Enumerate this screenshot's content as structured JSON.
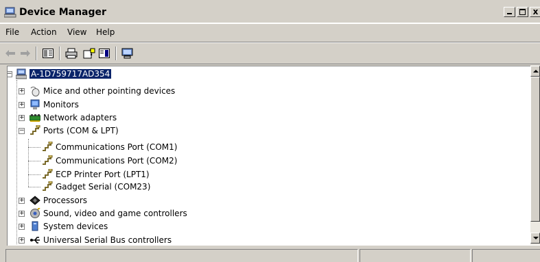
{
  "window": {
    "title": "Device Manager",
    "close_glyph": "x",
    "icon": "computer-icon"
  },
  "menu": {
    "items": [
      {
        "label": "File"
      },
      {
        "label": "Action"
      },
      {
        "label": "View"
      },
      {
        "label": "Help"
      }
    ]
  },
  "toolbar": {
    "icons": [
      "back-arrow-icon",
      "forward-arrow-icon",
      "show-hide-console-tree-icon",
      "print-icon",
      "help-icon",
      "properties-icon",
      "scan-hardware-icon"
    ]
  },
  "tree": {
    "root": {
      "label": "A-1D759717AD354",
      "icon": "computer-icon",
      "selected": true
    },
    "categories": [
      {
        "label": "Mice and other pointing devices",
        "icon": "mouse-icon",
        "expanded": false
      },
      {
        "label": "Monitors",
        "icon": "monitor-icon",
        "expanded": false
      },
      {
        "label": "Network adapters",
        "icon": "network-adapter-icon",
        "expanded": false
      },
      {
        "label": "Ports (COM & LPT)",
        "icon": "port-icon",
        "expanded": true,
        "children": [
          {
            "label": "Communications Port (COM1)",
            "icon": "port-icon"
          },
          {
            "label": "Communications Port (COM2)",
            "icon": "port-icon"
          },
          {
            "label": "ECP Printer Port (LPT1)",
            "icon": "port-icon"
          },
          {
            "label": "Gadget Serial (COM23)",
            "icon": "port-icon"
          }
        ]
      },
      {
        "label": "Processors",
        "icon": "processor-icon",
        "expanded": false
      },
      {
        "label": "Sound, video and game controllers",
        "icon": "sound-icon",
        "expanded": false
      },
      {
        "label": "System devices",
        "icon": "system-devices-icon",
        "expanded": false
      },
      {
        "label": "Universal Serial Bus controllers",
        "icon": "usb-icon",
        "expanded": false
      }
    ],
    "expander_collapsed": "+",
    "expander_expanded": "−"
  },
  "colors": {
    "selection": "#0a246a",
    "face": "#d4d0c8"
  }
}
